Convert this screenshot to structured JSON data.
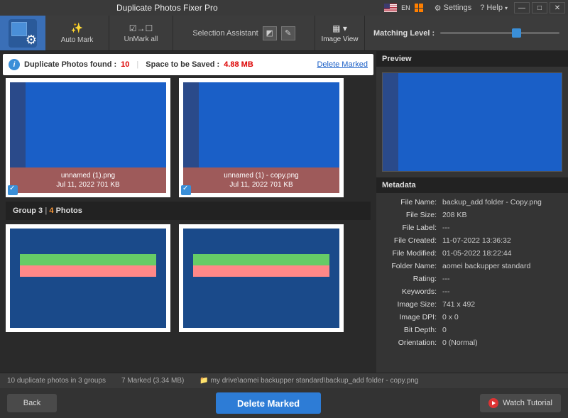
{
  "titlebar": {
    "title": "Duplicate Photos Fixer Pro",
    "lang": "EN",
    "settings": "Settings",
    "help": "Help"
  },
  "toolbar": {
    "auto_mark": "Auto Mark",
    "unmark_all": "UnMark all",
    "selection_assistant": "Selection Assistant",
    "image_view": "Image View",
    "matching_level": "Matching Level :"
  },
  "infobar": {
    "found_label": "Duplicate Photos found :",
    "found_count": "10",
    "space_label": "Space to be Saved :",
    "space_value": "4.88 MB",
    "delete_marked": "Delete Marked"
  },
  "group2": {
    "photos": [
      {
        "name": "unnamed (1).png",
        "meta": "Jul 11, 2022   701 KB"
      },
      {
        "name": "unnamed (1) - copy.png",
        "meta": "Jul 11, 2022   701 KB"
      }
    ]
  },
  "group3": {
    "label_a": "Group 3",
    "label_b": "4",
    "label_c": "Photos"
  },
  "preview": {
    "header": "Preview"
  },
  "metadata": {
    "header": "Metadata",
    "rows": [
      {
        "label": "File Name:",
        "value": "backup_add folder - Copy.png"
      },
      {
        "label": "File Size:",
        "value": "208 KB"
      },
      {
        "label": "File Label:",
        "value": "---"
      },
      {
        "label": "File Created:",
        "value": "11-07-2022 13:36:32"
      },
      {
        "label": "File Modified:",
        "value": "01-05-2022 18:22:44"
      },
      {
        "label": "Folder Name:",
        "value": "aomei backupper standard"
      },
      {
        "label": "Rating:",
        "value": "---"
      },
      {
        "label": "Keywords:",
        "value": "---"
      },
      {
        "label": "Image Size:",
        "value": "741 x 492"
      },
      {
        "label": "Image DPI:",
        "value": "0 x 0"
      },
      {
        "label": "Bit Depth:",
        "value": "0"
      },
      {
        "label": "Orientation:",
        "value": "0 (Normal)"
      }
    ]
  },
  "status": {
    "left": "10 duplicate photos in 3 groups",
    "mid": "7 Marked (3.34 MB)",
    "path": "my drive\\aomei backupper standard\\backup_add folder - copy.png"
  },
  "bottom": {
    "back": "Back",
    "delete": "Delete Marked",
    "watch": "Watch Tutorial"
  }
}
